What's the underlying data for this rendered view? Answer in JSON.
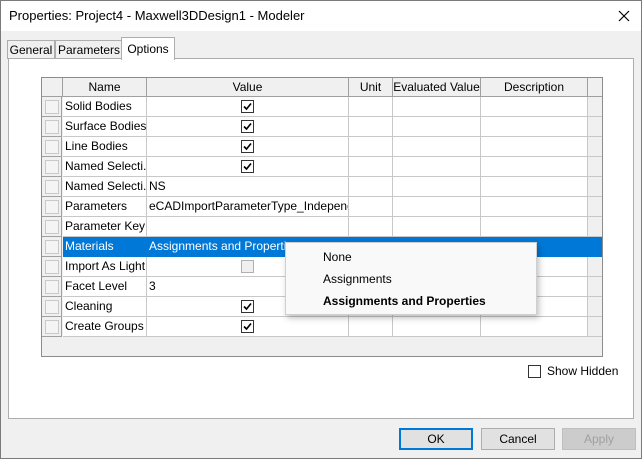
{
  "window": {
    "title": "Properties: Project4 - Maxwell3DDesign1 - Modeler"
  },
  "tabs": [
    {
      "label": "General"
    },
    {
      "label": "Parameters"
    },
    {
      "label": "Options"
    }
  ],
  "table": {
    "columns": [
      "Name",
      "Value",
      "Unit",
      "Evaluated Value",
      "Description"
    ],
    "rows": [
      {
        "name": "Solid Bodies",
        "value": "",
        "checkbox": "checked"
      },
      {
        "name": "Surface Bodies",
        "value": "",
        "checkbox": "checked"
      },
      {
        "name": "Line Bodies",
        "value": "",
        "checkbox": "checked"
      },
      {
        "name": "Named Selecti...",
        "value": "",
        "checkbox": "checked"
      },
      {
        "name": "Named Selecti...",
        "value": "NS",
        "checkbox": "none"
      },
      {
        "name": "Parameters",
        "value": "eCADImportParameterType_Independent",
        "checkbox": "none"
      },
      {
        "name": "Parameter Key",
        "value": "",
        "checkbox": "none"
      },
      {
        "name": "Materials",
        "value": "Assignments and Properties",
        "checkbox": "none",
        "selected": true
      },
      {
        "name": "Import As Light...",
        "value": "",
        "checkbox": "disabled"
      },
      {
        "name": "Facet Level",
        "value": "3",
        "checkbox": "none"
      },
      {
        "name": "Cleaning",
        "value": "",
        "checkbox": "checked"
      },
      {
        "name": "Create Groups ...",
        "value": "",
        "checkbox": "checked"
      }
    ]
  },
  "dropdown": {
    "options": [
      "None",
      "Assignments",
      "Assignments and Properties"
    ],
    "selected": "Assignments and Properties"
  },
  "show_hidden": {
    "label": "Show Hidden",
    "checked": false
  },
  "buttons": {
    "ok": "OK",
    "cancel": "Cancel",
    "apply": "Apply"
  },
  "colors": {
    "selection": "#0078d7",
    "default_button_border": "#0078d7"
  }
}
